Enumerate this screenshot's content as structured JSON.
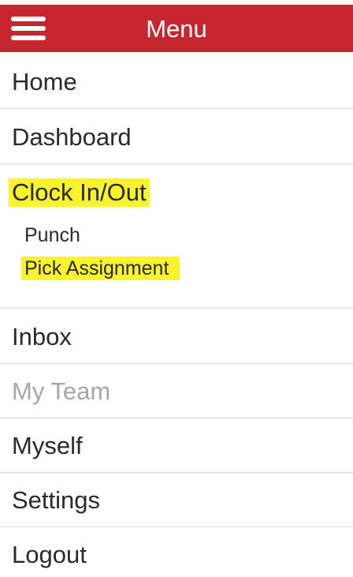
{
  "header": {
    "title": "Menu",
    "background_color": "#c6262e",
    "menu_icon": "hamburger-menu-icon"
  },
  "menu": {
    "home": "Home",
    "dashboard": "Dashboard",
    "clock": {
      "label": "Clock In/Out",
      "sub_items": [
        "Punch",
        "Pick Assignment"
      ]
    },
    "inbox": "Inbox",
    "my_team": "My Team",
    "myself": "Myself",
    "settings": "Settings",
    "logout": "Logout"
  },
  "highlight_color": "#f7f32e"
}
